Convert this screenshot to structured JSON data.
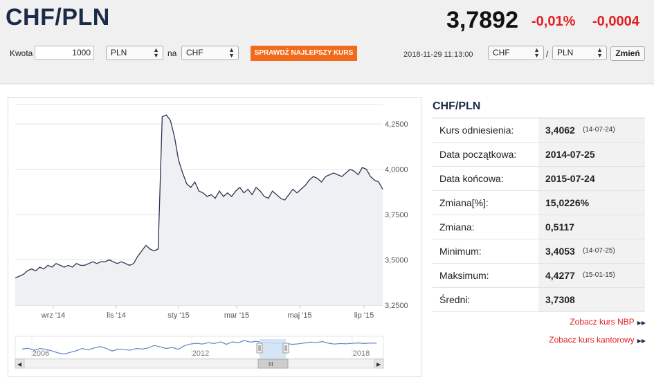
{
  "header": {
    "pair": "CHF/PLN",
    "rate": "3,7892",
    "change_pct": "-0,01%",
    "change_abs": "-0,0004"
  },
  "converter": {
    "amount_label": "Kwota",
    "amount_value": "1000",
    "from_currency": "PLN",
    "to_label": "na",
    "to_currency": "CHF",
    "best_rate_button": "SPRAWDŹ NAJLEPSZY KURS",
    "timestamp": "2018-11-29 11:13:00",
    "pair_base": "CHF",
    "pair_sep": "/",
    "pair_quote": "PLN",
    "change_button": "Zmień"
  },
  "chart_data": {
    "type": "line",
    "x_tick_labels": [
      "wrz '14",
      "lis '14",
      "sty '15",
      "mar '15",
      "maj '15",
      "lip '15"
    ],
    "y_tick_labels": [
      "3,2500",
      "3,5000",
      "3,7500",
      "4,0000",
      "4,2500"
    ],
    "ylim": [
      3.25,
      4.35
    ],
    "series": [
      {
        "values": [
          3.4,
          3.41,
          3.42,
          3.44,
          3.45,
          3.44,
          3.46,
          3.45,
          3.47,
          3.46,
          3.48,
          3.47,
          3.46,
          3.47,
          3.46,
          3.48,
          3.47,
          3.47,
          3.48,
          3.49,
          3.48,
          3.49,
          3.49,
          3.5,
          3.49,
          3.48,
          3.49,
          3.48,
          3.47,
          3.48,
          3.52,
          3.55,
          3.58,
          3.56,
          3.55,
          3.56,
          4.29,
          4.3,
          4.27,
          4.18,
          4.05,
          3.98,
          3.92,
          3.9,
          3.93,
          3.88,
          3.87,
          3.85,
          3.86,
          3.84,
          3.88,
          3.85,
          3.87,
          3.85,
          3.88,
          3.9,
          3.87,
          3.89,
          3.86,
          3.9,
          3.88,
          3.85,
          3.84,
          3.88,
          3.86,
          3.84,
          3.83,
          3.86,
          3.89,
          3.87,
          3.89,
          3.91,
          3.94,
          3.96,
          3.95,
          3.93,
          3.96,
          3.97,
          3.98,
          3.97,
          3.96,
          3.98,
          4.0,
          3.99,
          3.97,
          4.01,
          4.0,
          3.96,
          3.94,
          3.93,
          3.89
        ]
      }
    ],
    "navigator": {
      "x_tick_labels": [
        "2006",
        "2012",
        "2018"
      ],
      "series_values": [
        3.84,
        3.87,
        3.8,
        3.86,
        3.83,
        3.77,
        3.7,
        3.66,
        3.72,
        3.78,
        3.86,
        3.81,
        3.88,
        3.93,
        3.86,
        3.77,
        3.84,
        3.82,
        3.8,
        3.86,
        3.84,
        3.88,
        3.97,
        3.92,
        3.86,
        3.9,
        3.83,
        3.96,
        4.02,
        4.05,
        4.02,
        4.07,
        4.04,
        4.1,
        4.01,
        4.1,
        4.07,
        4.15,
        4.09,
        4.12,
        4.08,
        4.07,
        4.04,
        4.06,
        4.04,
        4.01,
        4.03,
        4.06,
        4.09,
        4.08,
        4.11,
        4.05,
        4.02,
        4.04,
        4.03,
        4.05,
        4.06,
        4.04,
        4.06,
        4.05
      ]
    }
  },
  "info": {
    "title": "CHF/PLN",
    "rows": [
      {
        "label": "Kurs odniesienia:",
        "value": "3,4062",
        "date": "(14-07-24)"
      },
      {
        "label": "Data początkowa:",
        "value": "2014-07-25",
        "date": ""
      },
      {
        "label": "Data końcowa:",
        "value": "2015-07-24",
        "date": ""
      },
      {
        "label": "Zmiana[%]:",
        "value": "15,0226%",
        "date": ""
      },
      {
        "label": "Zmiana:",
        "value": "0,5117",
        "date": ""
      },
      {
        "label": "Minimum:",
        "value": "3,4053",
        "date": "(14-07-25)"
      },
      {
        "label": "Maksimum:",
        "value": "4,4277",
        "date": "(15-01-15)"
      },
      {
        "label": "Średni:",
        "value": "3,7308",
        "date": ""
      }
    ],
    "link_nbp": "Zobacz kurs NBP",
    "link_exchange": "Zobacz kurs kantorowy"
  },
  "colors": {
    "accent_red": "#e31e24",
    "button_orange": "#f26b1d",
    "line_dark": "#2b3550",
    "navigator_line": "#5b87c5"
  }
}
